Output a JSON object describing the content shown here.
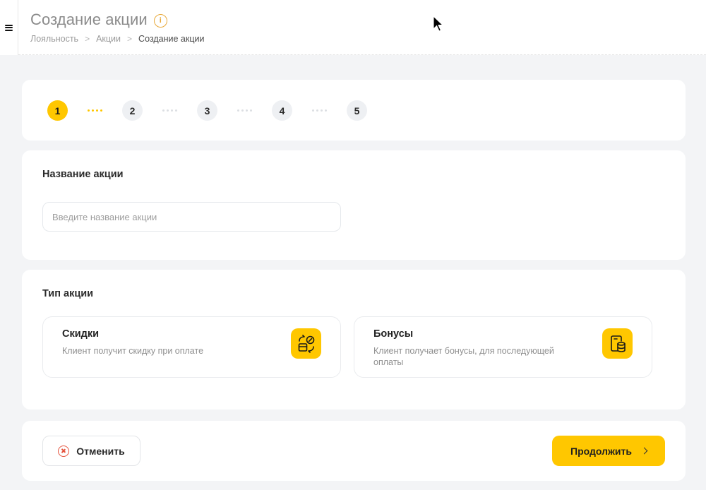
{
  "header": {
    "title": "Создание акции",
    "info_icon": "info-icon",
    "breadcrumbs": [
      "Лояльность",
      "Акции",
      "Создание акции"
    ],
    "breadcrumb_separator": ">"
  },
  "stepper": {
    "steps": [
      "1",
      "2",
      "3",
      "4",
      "5"
    ],
    "active_step": 1
  },
  "name_section": {
    "label": "Название акции",
    "input_value": "",
    "input_placeholder": "Введите название акции"
  },
  "type_section": {
    "label": "Тип акции",
    "options": [
      {
        "title": "Скидки",
        "description": "Клиент получит скидку при оплате",
        "icon": "discount-exchange-icon"
      },
      {
        "title": "Бонусы",
        "description": "Клиент получает бонусы, для последующей оплаты",
        "icon": "bonus-coins-icon"
      }
    ]
  },
  "actions": {
    "cancel_label": "Отменить",
    "continue_label": "Продолжить"
  },
  "colors": {
    "accent": "#ffc700",
    "cancel_red": "#e5533d",
    "info_orange": "#e8a93a",
    "background": "#f3f4f6"
  }
}
